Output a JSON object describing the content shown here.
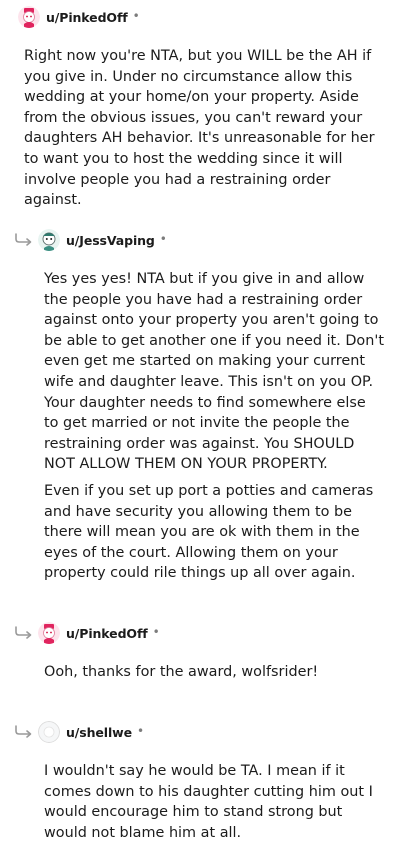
{
  "comments": [
    {
      "username": "u/PinkedOff",
      "separator": "•",
      "avatar_icon": "pink-snoo-avatar-icon",
      "paragraphs": [
        "Right now you're NTA, but you WILL be the AH if you give in. Under no circumstance allow this wedding at your home/on your property. Aside from the obvious issues, you can't reward your daughters AH behavior. It's unreasonable for her to want you to host the wedding since it will involve people you had a restraining order against."
      ]
    },
    {
      "username": "u/JessVaping",
      "separator": "•",
      "avatar_icon": "teal-snoo-avatar-icon",
      "reply_icon": "reply-arrow-icon",
      "paragraphs": [
        "Yes yes yes! NTA but if you give in and allow the people you have had a restraining order against onto your property you aren't going to be able to get another one if you need it. Don't even get me started on making your current wife and daughter leave. This isn't on you OP. Your daughter needs to find somewhere else to get married or not invite the people the restraining order was against. You SHOULD NOT ALLOW THEM ON YOUR PROPERTY.",
        "Even if you set up port a potties and cameras and have security you allowing them to be there will mean you are ok with them in the eyes of the court. Allowing them on your property could rile things up all over again."
      ]
    },
    {
      "username": "u/PinkedOff",
      "separator": "•",
      "avatar_icon": "pink-snoo-avatar-icon",
      "reply_icon": "reply-arrow-icon",
      "paragraphs": [
        "Ooh, thanks for the award, wolfsrider!"
      ]
    },
    {
      "username": "u/shellwe",
      "separator": "•",
      "avatar_icon": "default-avatar-icon",
      "reply_icon": "reply-arrow-icon",
      "paragraphs": [
        "I wouldn't say he would be TA. I mean if it comes down to his daughter cutting him out I would encourage him to stand strong but would not blame him at all."
      ]
    }
  ]
}
